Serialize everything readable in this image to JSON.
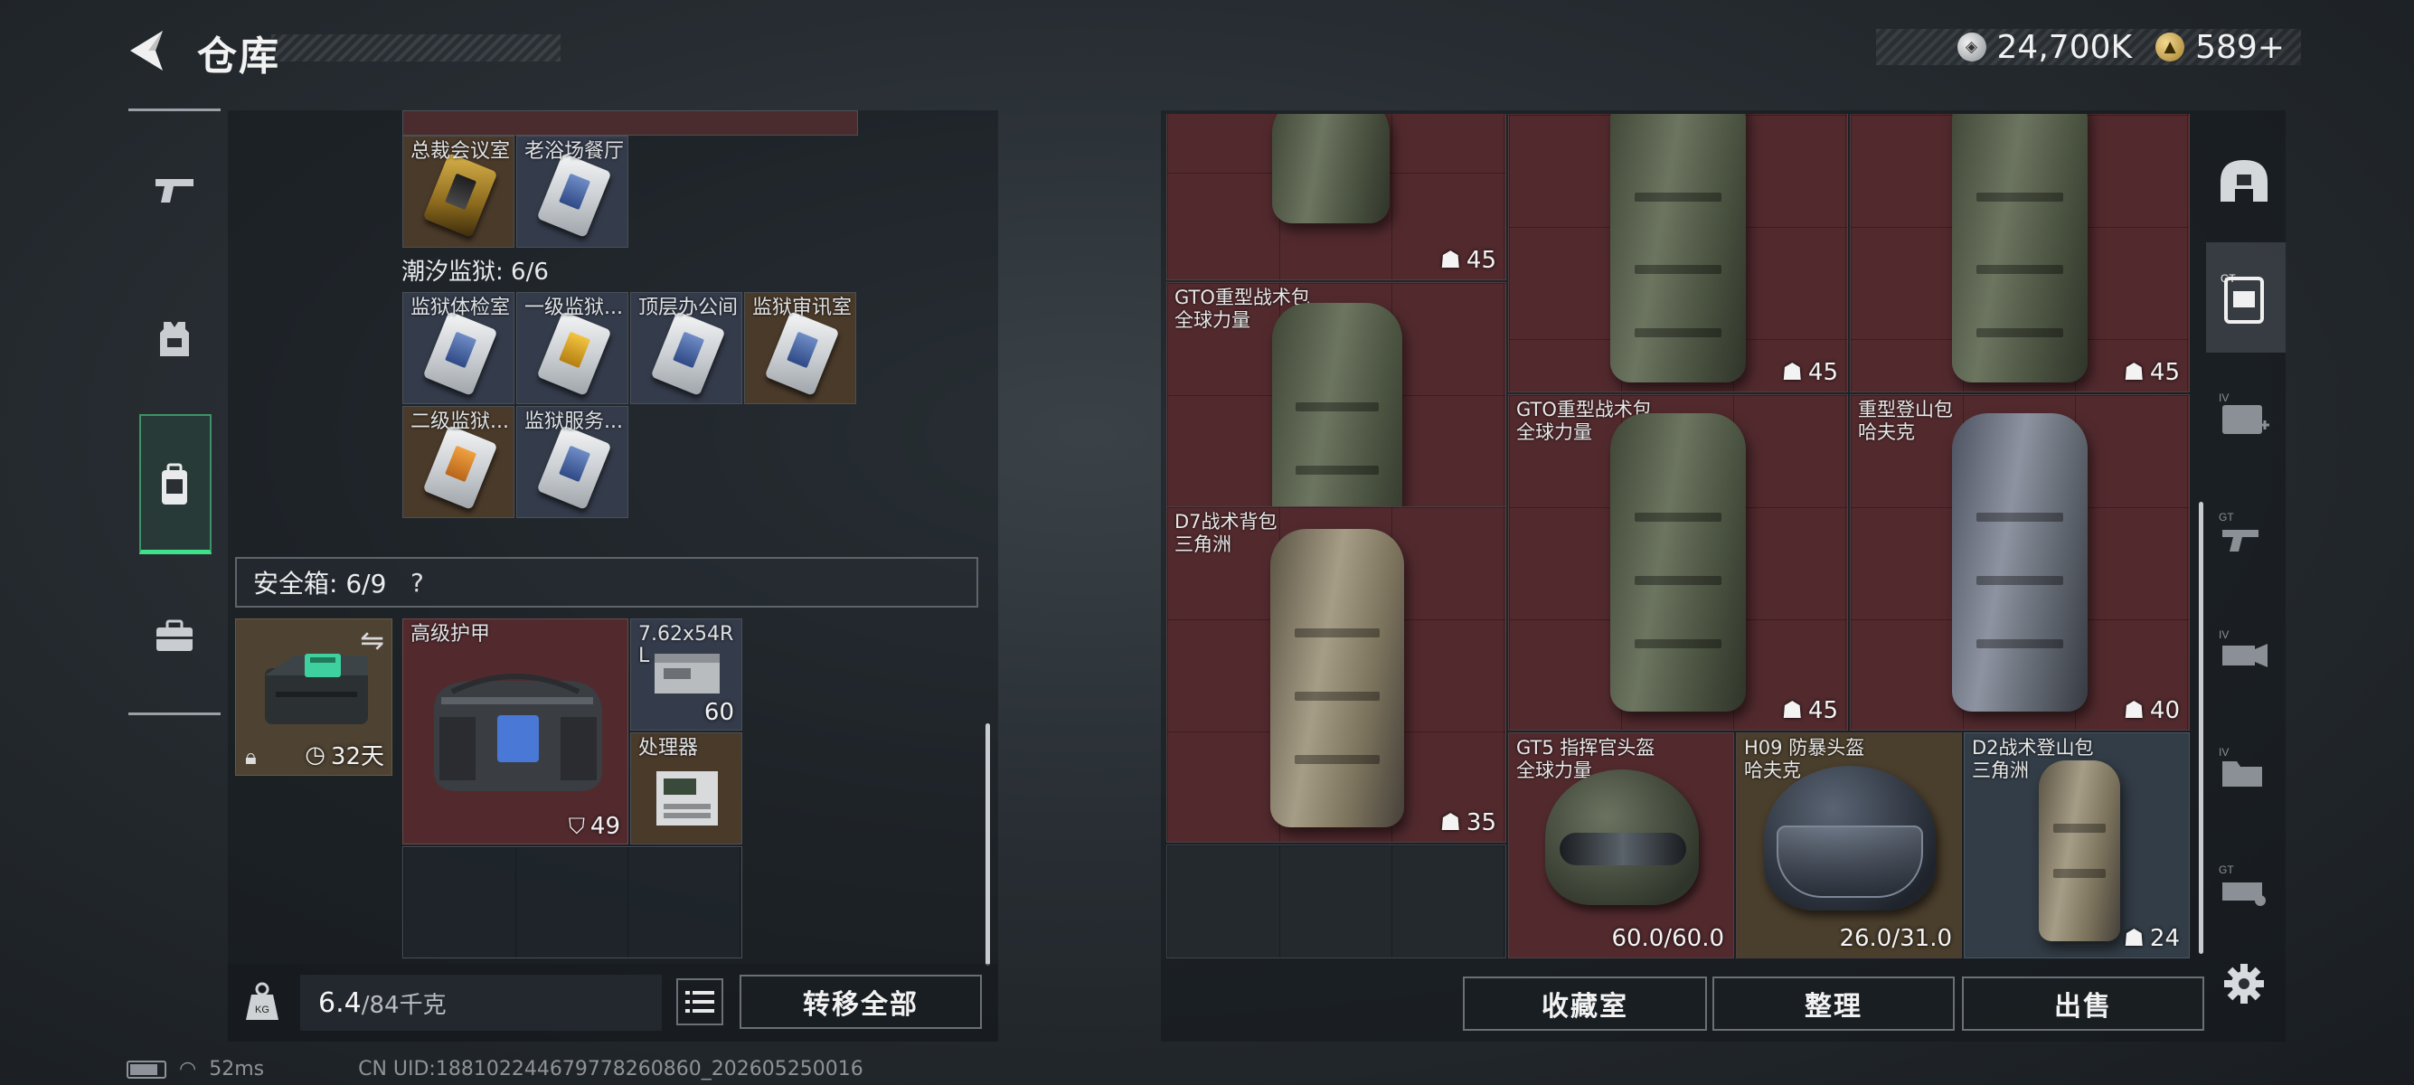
{
  "header": {
    "title": "仓库",
    "currency_silver": "24,700K",
    "currency_gold": "589+"
  },
  "nav": {
    "items": [
      {
        "name": "weapons",
        "icon": "pistol-icon"
      },
      {
        "name": "equipment",
        "icon": "armor-vest-icon"
      },
      {
        "name": "backpack",
        "icon": "backpack-icon",
        "active": true
      },
      {
        "name": "cases",
        "icon": "toolbox-icon"
      }
    ]
  },
  "keys_section": {
    "top_cells": [
      {
        "label": "总裁会议室",
        "card": "gold"
      },
      {
        "label": "老浴场餐厅",
        "card": "blue"
      }
    ],
    "prison_label": "潮汐监狱: 6/6",
    "prison_cells": [
      {
        "label": "监狱体检室",
        "card": "blue"
      },
      {
        "label": "一级监狱...",
        "card": "gold"
      },
      {
        "label": "顶层办公间",
        "card": "blue"
      },
      {
        "label": "监狱审讯室",
        "card": "blue"
      },
      {
        "label": "二级监狱...",
        "card": "orange"
      },
      {
        "label": "监狱服务...",
        "card": "blue"
      }
    ]
  },
  "safe_box": {
    "label": "安全箱: 6/9",
    "help": "?",
    "container_days": "32天",
    "items": {
      "armor": {
        "label": "高级护甲",
        "value": "49"
      },
      "ammo": {
        "label": "7.62x54R",
        "label2": "L",
        "qty": "60"
      },
      "processor": {
        "label": "处理器"
      }
    }
  },
  "weight": {
    "current": "6.4",
    "max": "/84千克"
  },
  "left_buttons": {
    "transfer_all": "转移全部"
  },
  "right_grid": {
    "items": [
      {
        "id": "top-partial",
        "label": "",
        "label2": "",
        "qty": "45"
      },
      {
        "id": "gto-1",
        "label": "GTO重型战术包",
        "label2": "全球力量",
        "qty": "45"
      },
      {
        "id": "gto-2",
        "label": "",
        "label2": "",
        "qty": "45"
      },
      {
        "id": "gto-3",
        "label": "",
        "label2": "",
        "qty": "45"
      },
      {
        "id": "gto-4",
        "label": "GTO重型战术包",
        "label2": "全球力量",
        "qty": "45"
      },
      {
        "id": "mountain",
        "label": "重型登山包",
        "label2": "哈夫克",
        "qty": "40"
      },
      {
        "id": "d7",
        "label": "D7战术背包",
        "label2": "三角洲",
        "qty": "35"
      },
      {
        "id": "gt5",
        "label": "GT5 指挥官头盔",
        "label2": "全球力量",
        "durability": "60.0/60.0"
      },
      {
        "id": "h09",
        "label": "H09 防暴头盔",
        "label2": "哈夫克",
        "durability": "26.0/31.0"
      },
      {
        "id": "d2",
        "label": "D2战术登山包",
        "label2": "三角洲",
        "qty": "24"
      }
    ]
  },
  "right_buttons": {
    "collection": "收藏室",
    "sort": "整理",
    "sell": "出售"
  },
  "footer": {
    "ping": "52ms",
    "uid": "CN UID:18810224467977826086​0_202605250016"
  },
  "colors": {
    "accent_green": "#3fe08a",
    "item_red": "#522a2e",
    "item_gray": "#333d47"
  }
}
